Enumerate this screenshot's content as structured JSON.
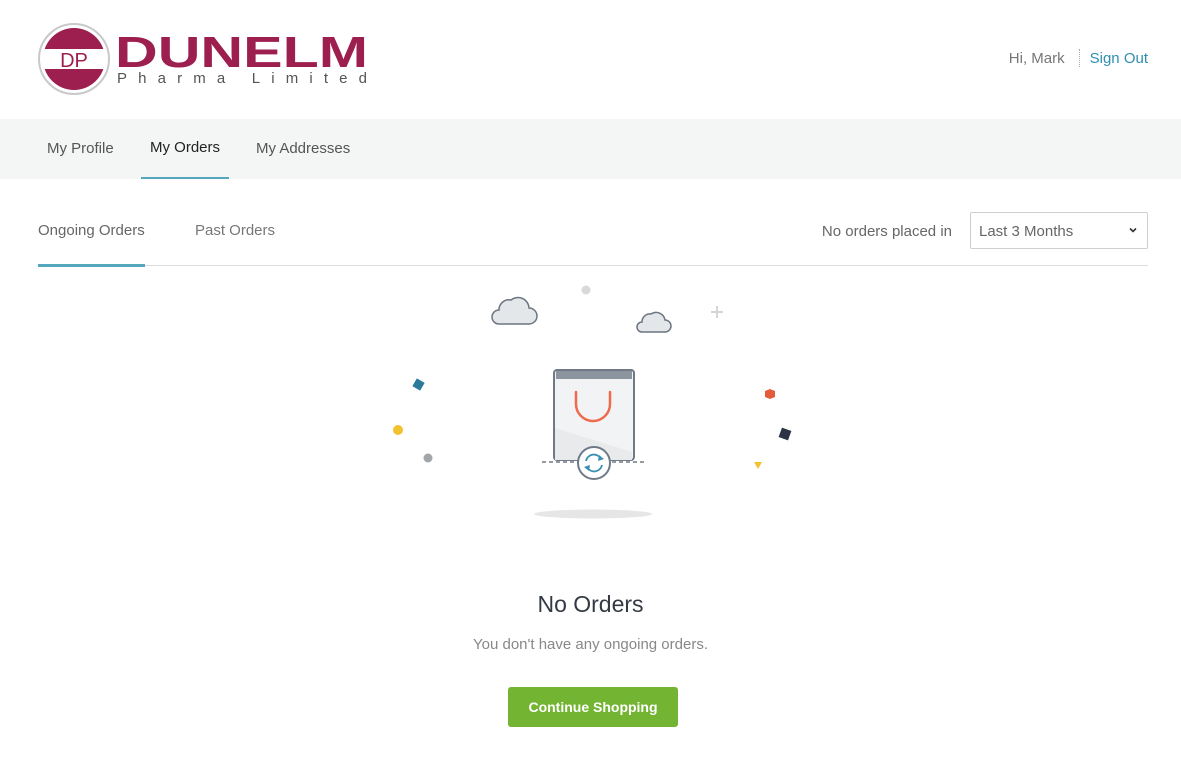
{
  "header": {
    "logo_initials": "DP",
    "logo_name": "DUNELM",
    "logo_tagline": "Pharma Limited",
    "greeting": "Hi, Mark",
    "sign_out": "Sign Out"
  },
  "nav": {
    "tabs": [
      {
        "label": "My Profile",
        "active": false
      },
      {
        "label": "My Orders",
        "active": true
      },
      {
        "label": "My Addresses",
        "active": false
      }
    ]
  },
  "orders": {
    "tabs": [
      {
        "label": "Ongoing Orders",
        "active": true
      },
      {
        "label": "Past Orders",
        "active": false
      }
    ],
    "filter_label": "No orders placed in",
    "filter_value": "Last 3 Months"
  },
  "empty_state": {
    "title": "No Orders",
    "message": "You don't have any ongoing orders.",
    "button": "Continue Shopping",
    "illustration_icons": [
      "shopping-bag-icon",
      "refresh-icon",
      "cloud-icon",
      "plus-icon"
    ]
  },
  "colors": {
    "brand": "#9c1f4f",
    "accent": "#55a7bd",
    "link": "#2e8fb0",
    "button": "#73b432"
  }
}
